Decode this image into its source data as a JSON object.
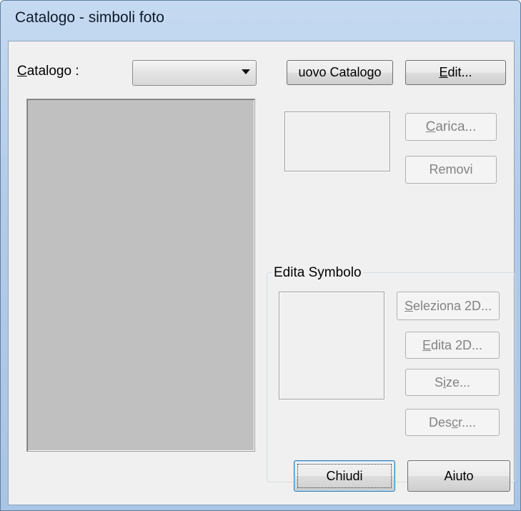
{
  "window": {
    "title": "Catalogo - simboli foto"
  },
  "catalog": {
    "label_access": "C",
    "label_rest": "atalogo :",
    "combo_value": ""
  },
  "buttons": {
    "nuovo_catalogo": "uovo Catalogo",
    "edit_access": "E",
    "edit_rest": "dit...",
    "carica_access": "C",
    "carica_rest": "arica...",
    "removi": "Removi",
    "chiudi": "Chiudi",
    "aiuto": "Aiuto"
  },
  "edita_symbolo": {
    "group_title": "Edita Symbolo",
    "seleziona_access": "S",
    "seleziona_rest": "eleziona 2D...",
    "edita_access": "E",
    "edita_rest": "dita 2D...",
    "size_pre": "S",
    "size_access": "i",
    "size_post": "ze...",
    "descr_pre": "Des",
    "descr_access": "c",
    "descr_post": "r...."
  },
  "icons": {
    "combo_arrow": "chevron-down-icon"
  }
}
